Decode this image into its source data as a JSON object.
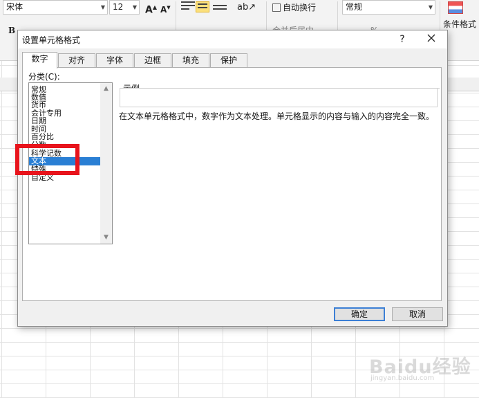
{
  "ribbon": {
    "font_name": "宋体",
    "font_size": "12",
    "grow_font": "A",
    "shrink_font": "A",
    "bold": "B",
    "wrap_text": "自动换行",
    "number_format": "常规",
    "conditional_format": "条件格式",
    "merge_center": "合并后居中",
    "percent": "%"
  },
  "dialog": {
    "title": "设置单元格格式",
    "help": "?",
    "tabs": [
      "数字",
      "对齐",
      "字体",
      "边框",
      "填充",
      "保护"
    ],
    "active_tab": "数字",
    "category_label": "分类(C):",
    "categories": [
      "常规",
      "数值",
      "货币",
      "会计专用",
      "日期",
      "时间",
      "百分比",
      "分数",
      "科学记数",
      "文本",
      "特殊",
      "自定义"
    ],
    "selected_category": "文本",
    "sample_label": "示例",
    "description": "在文本单元格格式中，数字作为文本处理。单元格显示的内容与输入的内容完全一致。",
    "ok_label": "确定",
    "cancel_label": "取消"
  },
  "watermark": {
    "brand": "Baidu经验",
    "url": "jingyan.baidu.com"
  },
  "colors": {
    "selection": "#2a7fd4",
    "highlight_box": "#e8141c",
    "default_button_border": "#3c7fd5"
  }
}
